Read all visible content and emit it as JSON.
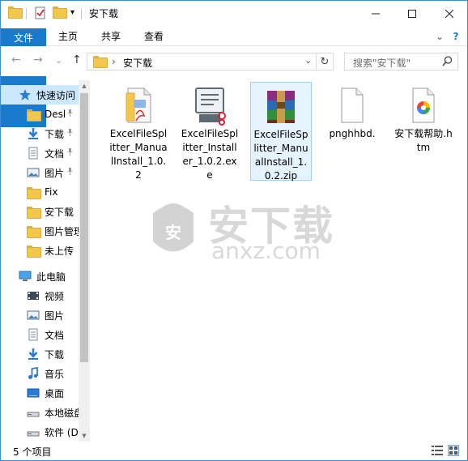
{
  "window": {
    "title": "安下载",
    "minimize_icon": "minimize-icon",
    "maximize_icon": "maximize-icon",
    "close_icon": "close-icon"
  },
  "quick_access_toolbar": {
    "dropdown_glyph": "▾"
  },
  "ribbon": {
    "tabs": [
      {
        "label": "文件"
      },
      {
        "label": "主页"
      },
      {
        "label": "共享"
      },
      {
        "label": "查看"
      }
    ],
    "expand_glyph": "⌄",
    "help_glyph": "?"
  },
  "navigation": {
    "back_glyph": "←",
    "forward_glyph": "→",
    "recent_glyph": "⌄",
    "up_glyph": "↑",
    "address_separator": "›",
    "address_path": "安下载",
    "address_dropdown_glyph": "⌄",
    "refresh_glyph": "↻"
  },
  "search": {
    "placeholder": "搜索\"安下载\"",
    "icon_glyph": "⚲"
  },
  "nav_pane": {
    "items": [
      {
        "label": "快速访问",
        "icon": "star-icon",
        "pinned": false
      },
      {
        "label": "Desl",
        "icon": "folder-icon",
        "pinned": true
      },
      {
        "label": "下载",
        "icon": "download-icon",
        "pinned": true
      },
      {
        "label": "文档",
        "icon": "document-icon",
        "pinned": true
      },
      {
        "label": "图片",
        "icon": "pictures-icon",
        "pinned": true
      },
      {
        "label": "Fix",
        "icon": "folder-icon",
        "pinned": false
      },
      {
        "label": "安下载",
        "icon": "folder-icon",
        "pinned": false
      },
      {
        "label": "图片管理",
        "icon": "folder-icon",
        "pinned": false
      },
      {
        "label": "未上传",
        "icon": "folder-icon",
        "pinned": false
      },
      {
        "label": "此电脑",
        "icon": "computer-icon",
        "pinned": false
      },
      {
        "label": "视频",
        "icon": "video-icon",
        "pinned": false
      },
      {
        "label": "图片",
        "icon": "pictures-icon",
        "pinned": false
      },
      {
        "label": "文档",
        "icon": "document-icon",
        "pinned": false
      },
      {
        "label": "下载",
        "icon": "download-icon",
        "pinned": false
      },
      {
        "label": "音乐",
        "icon": "music-icon",
        "pinned": false
      },
      {
        "label": "桌面",
        "icon": "desktop-icon",
        "pinned": false
      },
      {
        "label": "本地磁盘",
        "icon": "drive-icon",
        "pinned": false
      },
      {
        "label": "软件 (D",
        "icon": "drive-icon",
        "pinned": false
      }
    ],
    "pin_glyph": "📌",
    "scroll_up_glyph": "▲",
    "scroll_down_glyph": "▼"
  },
  "files": [
    {
      "name": "ExcelFileSplitter_ManualInstall_1.0.2",
      "icon": "pdf-document-icon",
      "selected": false
    },
    {
      "name": "ExcelFileSplitter_Installer_1.0.2.exe",
      "icon": "installer-icon",
      "selected": false
    },
    {
      "name": "ExcelFileSplitter_ManualInstall_1.0.2.zip",
      "icon": "winrar-archive-icon",
      "selected": true
    },
    {
      "name": "pnghhbd.",
      "icon": "blank-file-icon",
      "selected": false
    },
    {
      "name": "安下载帮助.htm",
      "icon": "html-file-icon",
      "selected": false
    }
  ],
  "watermark": {
    "text_cn": "安下载",
    "text_en": "anxz.com",
    "shield_glyph": "安"
  },
  "status_bar": {
    "item_count": "5 个项目",
    "details_view_icon": "details-view-icon",
    "large_icons_view_icon": "large-icons-view-icon"
  },
  "colors": {
    "accent": "#1979ca",
    "selection": "#cce8ff",
    "folder": "#f3c74e"
  }
}
